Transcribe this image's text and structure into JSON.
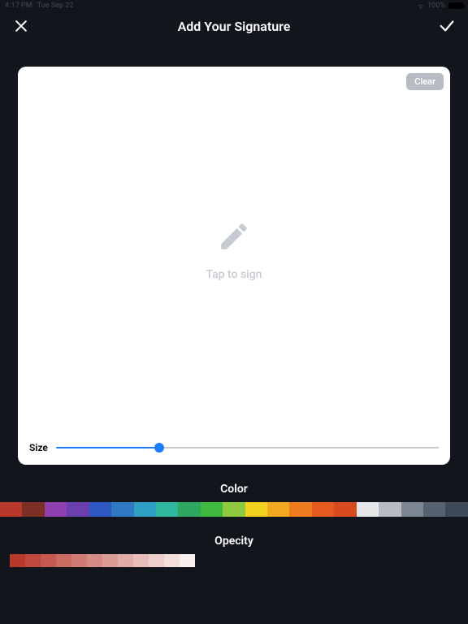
{
  "status": {
    "time": "4:17 PM",
    "date": "Tue Sep 22",
    "battery": "100%"
  },
  "header": {
    "title": "Add Your Signature"
  },
  "canvas": {
    "clear_label": "Clear",
    "placeholder": "Tap to sign",
    "size_label": "Size",
    "size_percent": 27
  },
  "sections": {
    "color_label": "Color",
    "opacity_label": "Opecity"
  },
  "colors": [
    "#b9382c",
    "#7c2f24",
    "#8f3fae",
    "#6a3fae",
    "#2f57c4",
    "#2f79c4",
    "#2fa0c4",
    "#2fb69e",
    "#2fa85f",
    "#3fb83f",
    "#8fc93f",
    "#f2d21f",
    "#f2a81f",
    "#ef7c1f",
    "#e45a1f",
    "#d84b1f",
    "#e6e7e8",
    "#b7bcc4",
    "#7d8793",
    "#566270",
    "#3e4a59"
  ],
  "opacity_base": "#b9382c",
  "opacity_steps": 12
}
